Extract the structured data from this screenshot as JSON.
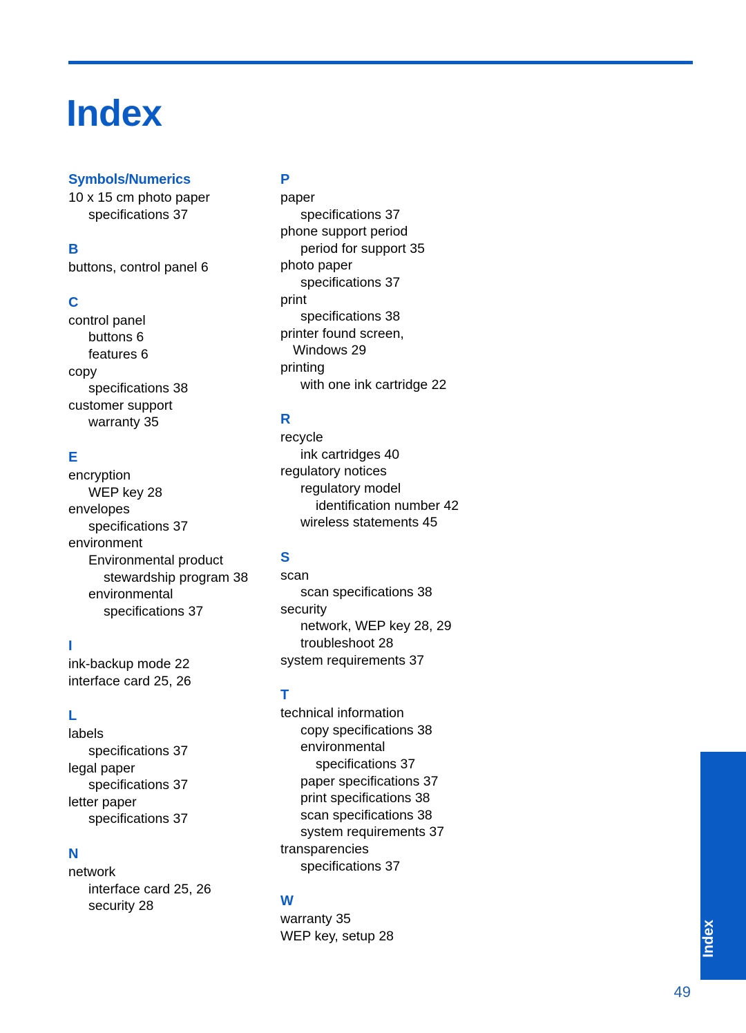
{
  "document": {
    "title": "Index",
    "page_number": "49",
    "side_tab_label": "Index",
    "accent_color": "#0B5BC4",
    "text_color": "#000000",
    "background_color": "#FFFFFF"
  },
  "columns": [
    {
      "name": "left-column",
      "sections": [
        {
          "letter": "Symbols/Numerics",
          "entries": [
            {
              "text": "10 x 15 cm photo paper",
              "level": 1
            },
            {
              "text": "specifications 37",
              "level": 2
            }
          ]
        },
        {
          "letter": "B",
          "entries": [
            {
              "text": "buttons, control panel 6",
              "level": 1
            }
          ]
        },
        {
          "letter": "C",
          "entries": [
            {
              "text": "control panel",
              "level": 1
            },
            {
              "text": "buttons 6",
              "level": 2
            },
            {
              "text": "features 6",
              "level": 2
            },
            {
              "text": "copy",
              "level": 1
            },
            {
              "text": "specifications 38",
              "level": 2
            },
            {
              "text": "customer support",
              "level": 1
            },
            {
              "text": "warranty 35",
              "level": 2
            }
          ]
        },
        {
          "letter": "E",
          "entries": [
            {
              "text": "encryption",
              "level": 1
            },
            {
              "text": "WEP key 28",
              "level": 2
            },
            {
              "text": "envelopes",
              "level": 1
            },
            {
              "text": "specifications 37",
              "level": 2
            },
            {
              "text": "environment",
              "level": 1
            },
            {
              "text": "Environmental product",
              "level": 2
            },
            {
              "text": "stewardship program 38",
              "level": 3
            },
            {
              "text": "environmental",
              "level": 2
            },
            {
              "text": "specifications 37",
              "level": 3
            }
          ]
        },
        {
          "letter": "I",
          "entries": [
            {
              "text": "ink-backup mode 22",
              "level": 1
            },
            {
              "text": "interface card 25, 26",
              "level": 1
            }
          ]
        },
        {
          "letter": "L",
          "entries": [
            {
              "text": "labels",
              "level": 1
            },
            {
              "text": "specifications 37",
              "level": 2
            },
            {
              "text": "legal paper",
              "level": 1
            },
            {
              "text": "specifications 37",
              "level": 2
            },
            {
              "text": "letter paper",
              "level": 1
            },
            {
              "text": "specifications 37",
              "level": 2
            }
          ]
        },
        {
          "letter": "N",
          "entries": [
            {
              "text": "network",
              "level": 1
            },
            {
              "text": "interface card 25, 26",
              "level": 2
            },
            {
              "text": "security 28",
              "level": 2
            }
          ]
        }
      ]
    },
    {
      "name": "right-column",
      "sections": [
        {
          "letter": "P",
          "entries": [
            {
              "text": "paper",
              "level": 1
            },
            {
              "text": "specifications 37",
              "level": 2
            },
            {
              "text": "phone support period",
              "level": 1
            },
            {
              "text": "period for support 35",
              "level": 2
            },
            {
              "text": "photo paper",
              "level": 1
            },
            {
              "text": "specifications 37",
              "level": 2
            },
            {
              "text": "print",
              "level": 1
            },
            {
              "text": "specifications 38",
              "level": 2
            },
            {
              "text": "printer found screen,",
              "level": 1
            },
            {
              "text": "Windows 29",
              "level": 1.5
            },
            {
              "text": "printing",
              "level": 1
            },
            {
              "text": "with one ink cartridge 22",
              "level": 2
            }
          ]
        },
        {
          "letter": "R",
          "entries": [
            {
              "text": "recycle",
              "level": 1
            },
            {
              "text": "ink cartridges 40",
              "level": 2
            },
            {
              "text": "regulatory notices",
              "level": 1
            },
            {
              "text": "regulatory model",
              "level": 2
            },
            {
              "text": "identification number 42",
              "level": 3
            },
            {
              "text": "wireless statements 45",
              "level": 2
            }
          ]
        },
        {
          "letter": "S",
          "entries": [
            {
              "text": "scan",
              "level": 1
            },
            {
              "text": "scan specifications 38",
              "level": 2
            },
            {
              "text": "security",
              "level": 1
            },
            {
              "text": "network, WEP key 28, 29",
              "level": 2
            },
            {
              "text": "troubleshoot 28",
              "level": 2
            },
            {
              "text": "system requirements 37",
              "level": 1
            }
          ]
        },
        {
          "letter": "T",
          "entries": [
            {
              "text": "technical information",
              "level": 1
            },
            {
              "text": "copy specifications 38",
              "level": 2
            },
            {
              "text": "environmental",
              "level": 2
            },
            {
              "text": "specifications 37",
              "level": 3
            },
            {
              "text": "paper specifications 37",
              "level": 2
            },
            {
              "text": "print specifications 38",
              "level": 2
            },
            {
              "text": "scan specifications 38",
              "level": 2
            },
            {
              "text": "system requirements 37",
              "level": 2
            },
            {
              "text": "transparencies",
              "level": 1
            },
            {
              "text": "specifications 37",
              "level": 2
            }
          ]
        },
        {
          "letter": "W",
          "entries": [
            {
              "text": "warranty 35",
              "level": 1
            },
            {
              "text": "WEP key, setup 28",
              "level": 1
            }
          ]
        }
      ]
    }
  ]
}
